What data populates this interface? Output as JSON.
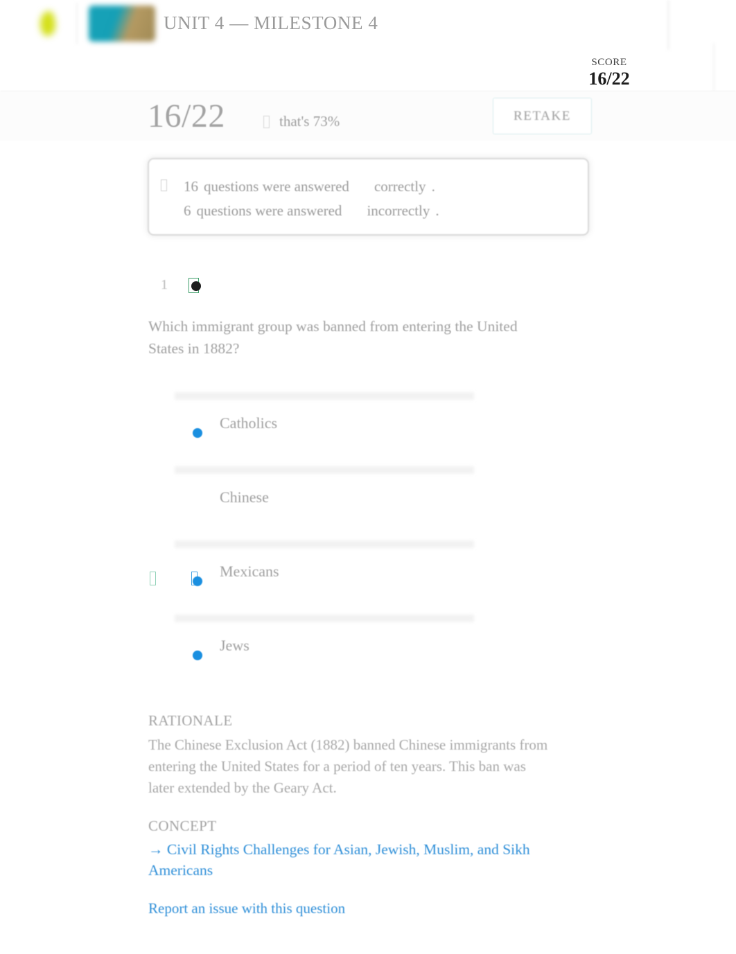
{
  "header": {
    "unit_title": "UNIT 4 — MILESTONE 4",
    "logo_icon": "logo-leaf-icon",
    "course_icon": "course-thumbnail-icon"
  },
  "score_panel": {
    "label": "SCORE",
    "value": "16/22"
  },
  "summary": {
    "big_score": "16/22",
    "percent_text": "that's 73%",
    "retake_label": "RETAKE",
    "correct_count": "16",
    "correct_sentence_mid": "questions were answered",
    "correct_adverb": "correctly",
    "correct_period": ".",
    "incorrect_count": "6",
    "incorrect_sentence_mid": "questions were answered",
    "incorrect_adverb": "incorrectly",
    "incorrect_period": "."
  },
  "question": {
    "number": "1",
    "status_icon": "question-status-icon",
    "text": "Which immigrant group was banned from entering the United States in 1882?",
    "options": [
      {
        "label": "Catholics",
        "selected": false
      },
      {
        "label": "Chinese",
        "selected": true
      },
      {
        "label": "Mexicans",
        "selected": false
      },
      {
        "label": "Jews",
        "selected": false
      }
    ]
  },
  "rationale": {
    "heading": "RATIONALE",
    "body": "The Chinese Exclusion Act (1882) banned Chinese immigrants from entering the United States for a period of ten years. This ban was later extended by the Geary Act."
  },
  "concept": {
    "heading": "CONCEPT",
    "link": "→ Civil Rights Challenges for Asian, Jewish, Muslim, and Sikh Americans"
  },
  "report": {
    "link": "Report an issue with this question"
  },
  "colors": {
    "accent_blue": "#2f8fd8",
    "option_dot": "#1a8fe0",
    "retake_border": "#d7ecee",
    "correct_green": "#3f9e6a"
  }
}
